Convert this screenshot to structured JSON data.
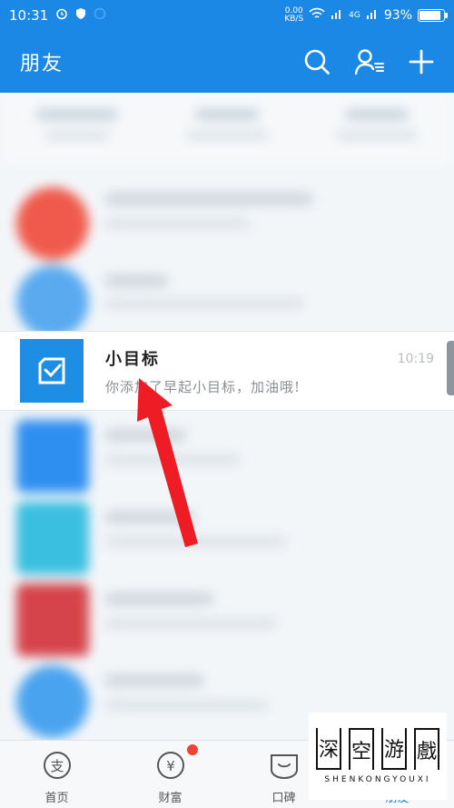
{
  "status_bar": {
    "time": "10:31",
    "net_speed_value": "0.00",
    "net_speed_unit": "KB/S",
    "signal_label": "4G",
    "battery_percent": "93%",
    "battery_level": 0.93
  },
  "header": {
    "title": "朋友",
    "icons": [
      "search-icon",
      "contacts-icon",
      "add-icon"
    ]
  },
  "colors": {
    "brand_blue": "#1c88e6",
    "arrow_red": "#ee1c24",
    "badge_red": "#f04134"
  },
  "highlighted_contact": {
    "name": "小目标",
    "message": "你添加了早起小目标，加油哦!",
    "time": "10:19",
    "icon": "checkbox-icon"
  },
  "tabs": [
    {
      "label": "首页",
      "icon": "alipay-icon"
    },
    {
      "label": "财富",
      "icon": "yen-icon",
      "badge": true
    },
    {
      "label": "口碑",
      "icon": "koubei-icon"
    },
    {
      "label": "朋友",
      "icon": "friends-icon"
    }
  ],
  "watermark": {
    "chars": [
      "深",
      "空",
      "游",
      "戲"
    ],
    "subtitle": "SHENKONGYOUXI"
  }
}
